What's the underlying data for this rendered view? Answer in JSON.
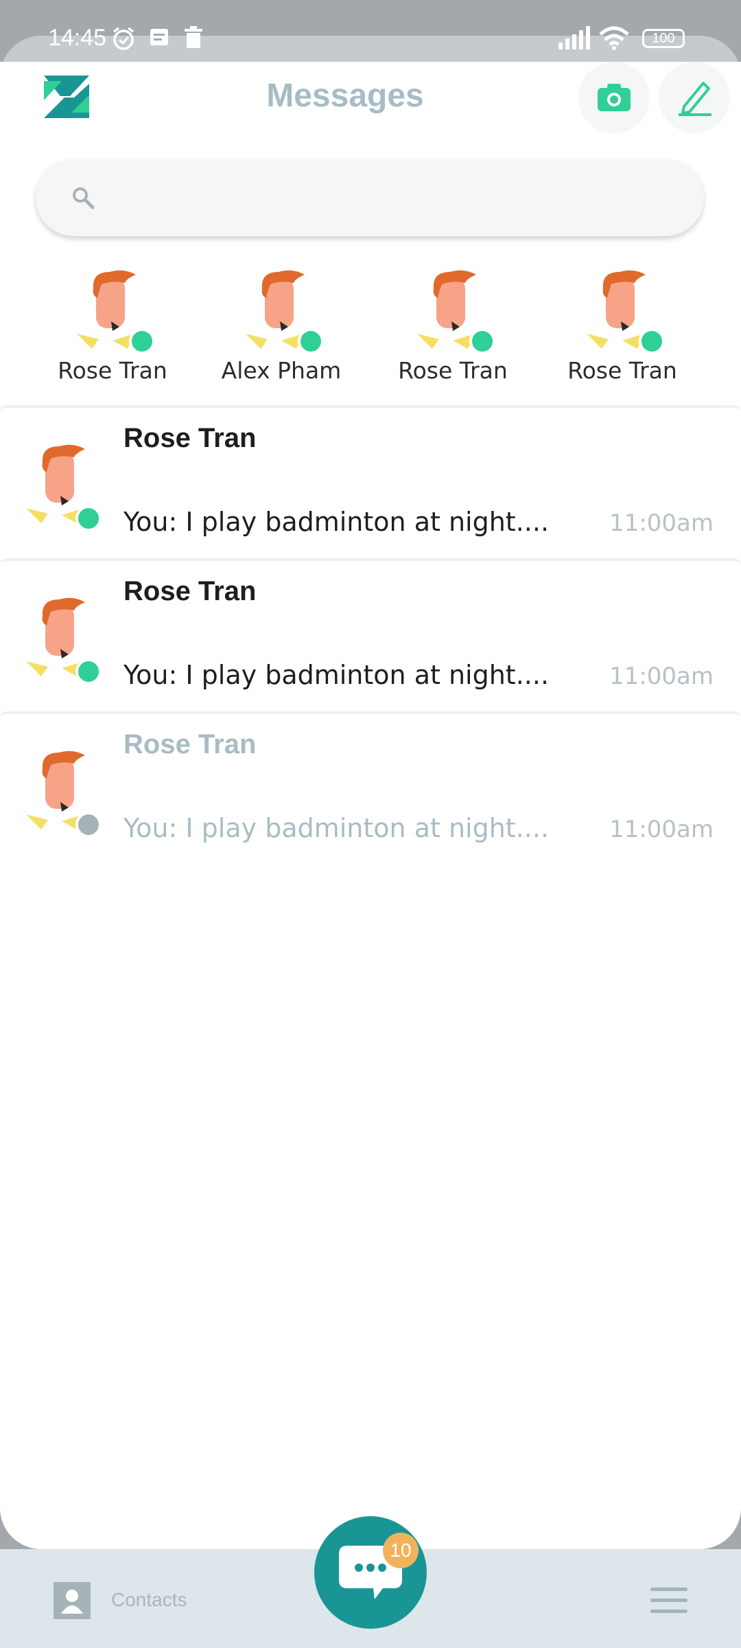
{
  "status_bar": {
    "time": "14:45",
    "battery": "100"
  },
  "header": {
    "title": "Messages"
  },
  "search": {
    "placeholder": ""
  },
  "stories": [
    {
      "name": "Rose Tran",
      "status": "online"
    },
    {
      "name": "Alex Pham",
      "status": "online"
    },
    {
      "name": "Rose Tran",
      "status": "online"
    },
    {
      "name": "Rose Tran",
      "status": "online"
    }
  ],
  "conversations": [
    {
      "name": "Rose Tran",
      "message": "You: I play badminton at night....",
      "time": "11:00am",
      "status": "online"
    },
    {
      "name": "Rose Tran",
      "message": "You: I play badminton at night....",
      "time": "11:00am",
      "status": "online"
    },
    {
      "name": "Rose Tran",
      "message": "You: I play badminton at night....",
      "time": "11:00am",
      "status": "offline"
    }
  ],
  "bottom_nav": {
    "contacts_label": "Contacts",
    "unread_count": "10"
  },
  "colors": {
    "accent": "#1a9595",
    "online": "#2fcf96",
    "offline": "#a5b3b9",
    "badge": "#f0b35b"
  }
}
